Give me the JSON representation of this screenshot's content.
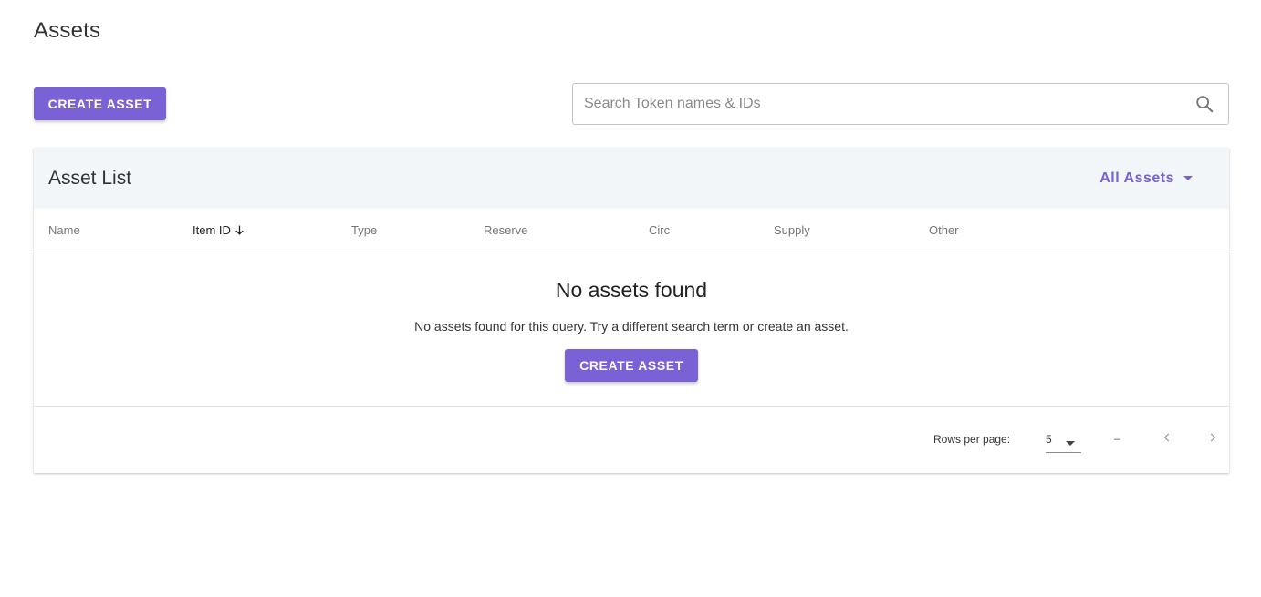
{
  "page": {
    "title": "Assets"
  },
  "toolbar": {
    "create_label": "CREATE ASSET",
    "search_placeholder": "Search Token names & IDs",
    "search_value": ""
  },
  "card": {
    "title": "Asset List",
    "filter_label": "All Assets"
  },
  "table": {
    "columns": [
      "Name",
      "Item ID",
      "Type",
      "Reserve",
      "Circ",
      "Supply",
      "Other"
    ],
    "sorted_column": "Item ID",
    "sort_direction": "descending",
    "rows": []
  },
  "empty": {
    "title": "No assets found",
    "description": "No assets found for this query. Try a different search term or create an asset.",
    "create_label": "CREATE ASSET"
  },
  "pagination": {
    "rows_per_page_label": "Rows per page:",
    "rows_per_page_value": "5",
    "range_text": "–"
  },
  "colors": {
    "accent": "#7b61d6",
    "header_bg": "#f2f6f9"
  },
  "icons": {
    "search": "search-icon",
    "sort": "arrow-down-icon",
    "filter_caret": "caret-down-icon",
    "prev": "chevron-left-icon",
    "next": "chevron-right-icon"
  }
}
